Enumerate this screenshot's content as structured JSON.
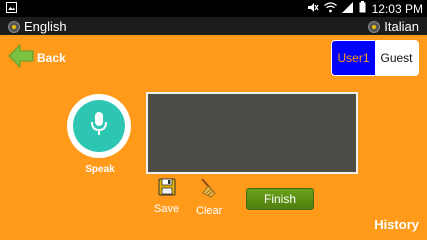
{
  "status_bar": {
    "time": "12:03 PM",
    "icons": [
      "image-icon",
      "mute-icon",
      "wifi-icon",
      "signal-icon",
      "battery-icon"
    ]
  },
  "languages": {
    "source": "English",
    "target": "Italian"
  },
  "header": {
    "back_label": "Back",
    "user_label": "User1",
    "guest_label": "Guest"
  },
  "speak": {
    "label": "Speak"
  },
  "actions": {
    "save_label": "Save",
    "clear_label": "Clear",
    "finish_label": "Finish",
    "history_label": "History"
  },
  "colors": {
    "background": "#ff9a1a",
    "mic": "#2cc6b3",
    "user_toggle": "#0000ff",
    "finish": "#5f9a14",
    "text_area": "#4a4d45"
  }
}
